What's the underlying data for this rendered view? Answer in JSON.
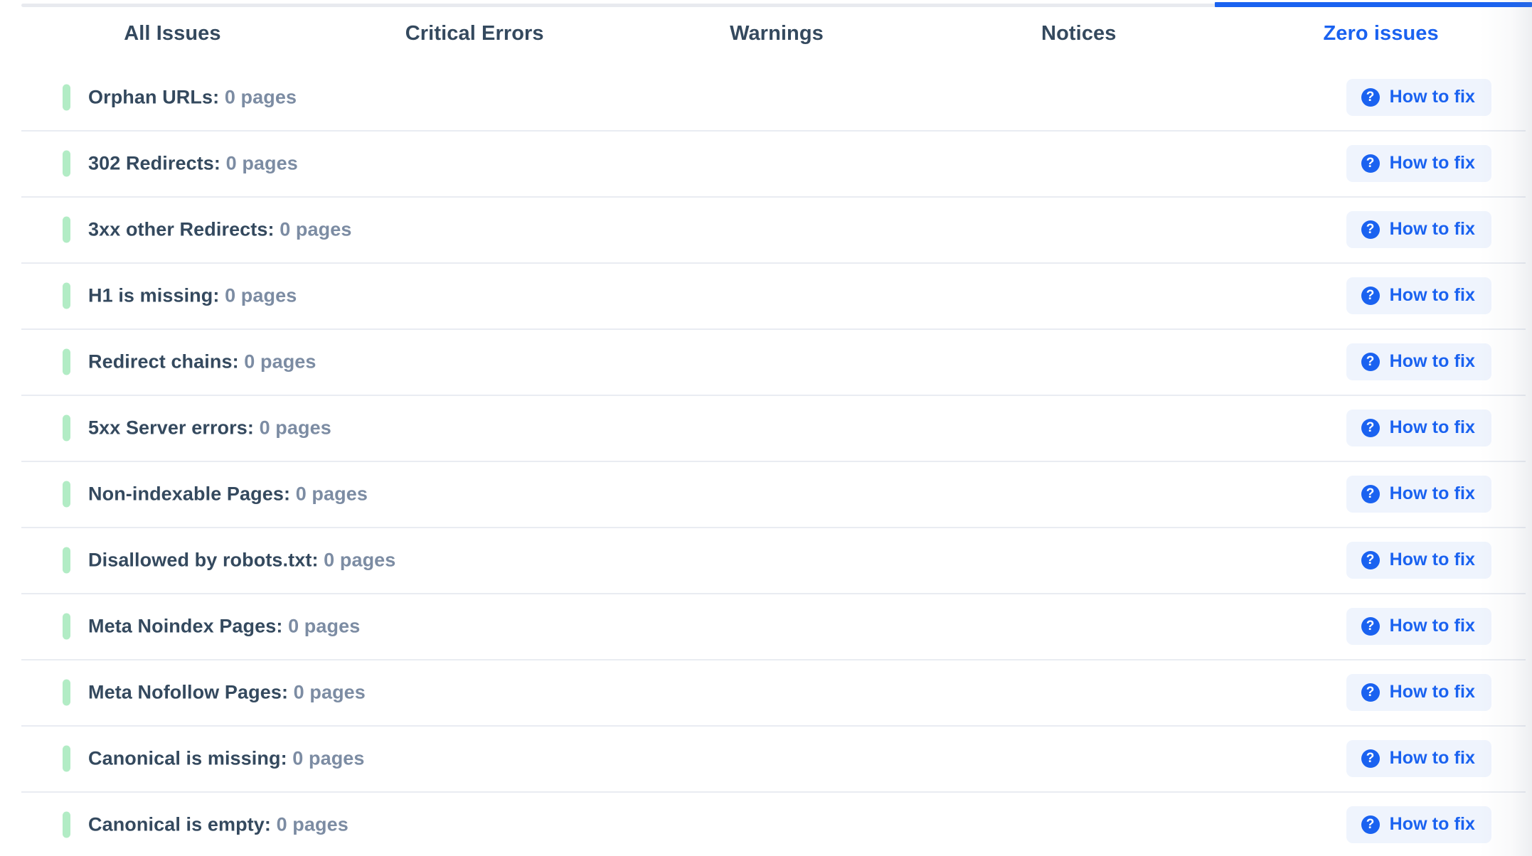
{
  "colors": {
    "accent": "#1a62f0",
    "text_dark": "#34495e",
    "text_muted": "#7c8ca3",
    "marker_green": "#b2ecc5",
    "button_bg": "#eff4fd",
    "divider": "#e9ecf2",
    "rule_inactive": "#e8eaef"
  },
  "tabs": [
    {
      "label": "All Issues",
      "active": false
    },
    {
      "label": "Critical Errors",
      "active": false
    },
    {
      "label": "Warnings",
      "active": false
    },
    {
      "label": "Notices",
      "active": false
    },
    {
      "label": "Zero issues",
      "active": true
    }
  ],
  "action": {
    "label": "How to fix",
    "icon": "question-mark-circle-icon"
  },
  "issues": [
    {
      "name": "Orphan URLs",
      "separator": ": ",
      "count": "0 pages",
      "severity": "zero"
    },
    {
      "name": "302 Redirects",
      "separator": ": ",
      "count": "0 pages",
      "severity": "zero"
    },
    {
      "name": "3xx other Redirects",
      "separator": ": ",
      "count": "0 pages",
      "severity": "zero"
    },
    {
      "name": "H1 is missing",
      "separator": ": ",
      "count": "0 pages",
      "severity": "zero"
    },
    {
      "name": "Redirect chains",
      "separator": ": ",
      "count": "0 pages",
      "severity": "zero"
    },
    {
      "name": "5xx Server errors",
      "separator": ": ",
      "count": "0 pages",
      "severity": "zero"
    },
    {
      "name": "Non-indexable Pages",
      "separator": ": ",
      "count": "0 pages",
      "severity": "zero"
    },
    {
      "name": "Disallowed by robots.txt",
      "separator": ": ",
      "count": "0 pages",
      "severity": "zero"
    },
    {
      "name": "Meta Noindex Pages",
      "separator": ": ",
      "count": "0 pages",
      "severity": "zero"
    },
    {
      "name": "Meta Nofollow Pages",
      "separator": ": ",
      "count": "0 pages",
      "severity": "zero"
    },
    {
      "name": "Canonical is missing",
      "separator": ": ",
      "count": "0 pages",
      "severity": "zero"
    },
    {
      "name": "Canonical is empty",
      "separator": ": ",
      "count": "0 pages",
      "severity": "zero"
    }
  ]
}
